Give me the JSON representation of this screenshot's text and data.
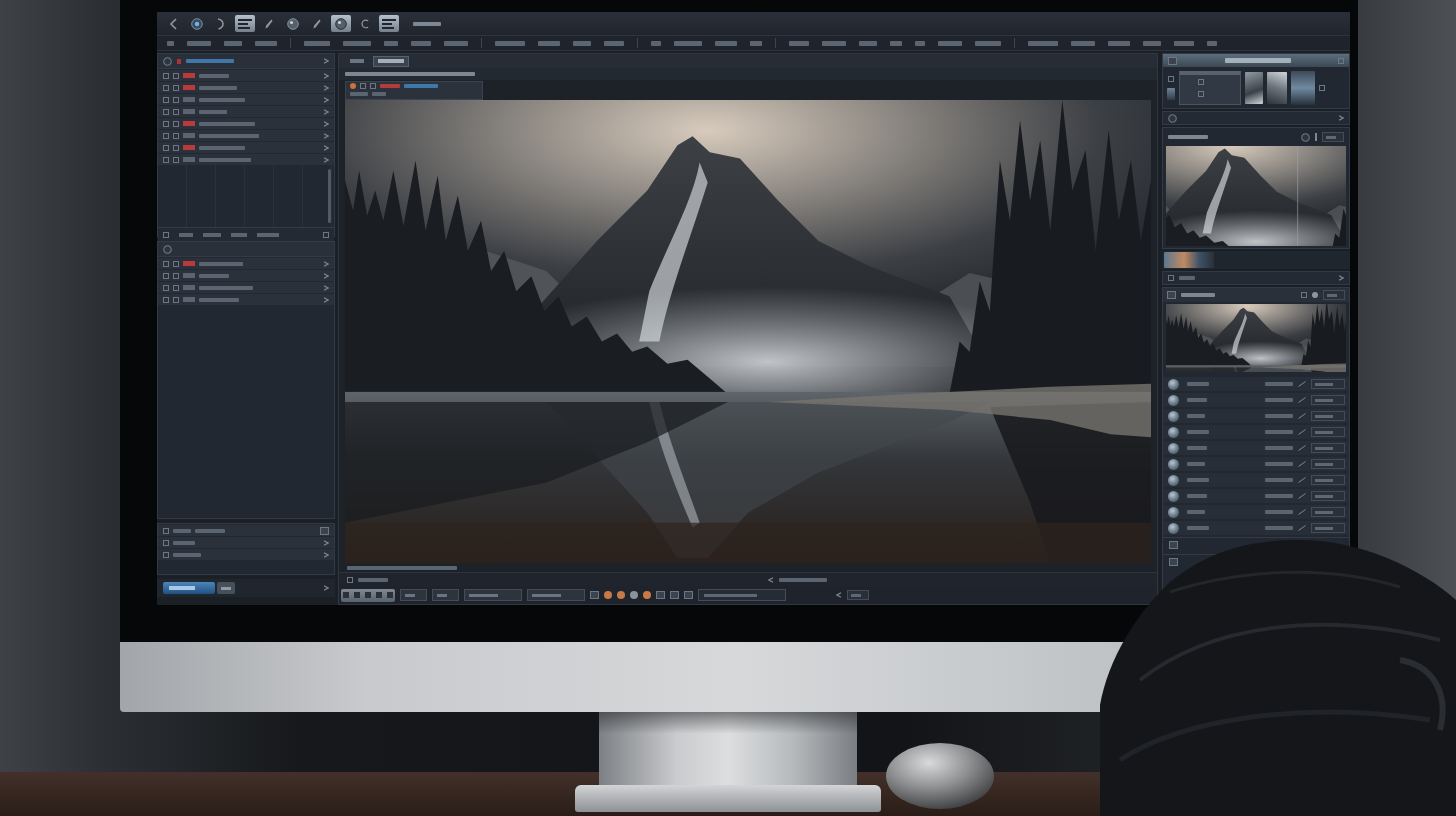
{
  "toolbar": {
    "tools": [
      {
        "kind": "back",
        "selected": false
      },
      {
        "kind": "dot",
        "selected": false
      },
      {
        "kind": "curve",
        "selected": false
      },
      {
        "kind": "bars",
        "selected": true
      },
      {
        "kind": "pen",
        "selected": false
      },
      {
        "kind": "lens",
        "selected": false
      },
      {
        "kind": "pen",
        "selected": false
      },
      {
        "kind": "lens",
        "selected": true
      },
      {
        "kind": "hook",
        "selected": false
      },
      {
        "kind": "bars",
        "selected": true
      }
    ]
  },
  "layers_panel": {
    "rows": [
      {
        "flagged": true
      },
      {
        "flagged": true
      },
      {
        "flagged": false
      },
      {
        "flagged": false
      },
      {
        "flagged": true
      },
      {
        "flagged": false
      },
      {
        "flagged": true
      },
      {
        "flagged": false
      }
    ]
  },
  "adjustments_panel": {
    "rows": [
      {
        "flagged": true
      },
      {
        "flagged": false
      },
      {
        "flagged": false
      },
      {
        "flagged": false
      }
    ]
  },
  "viewer": {
    "tabs": [
      {
        "selected": false
      },
      {
        "selected": true
      }
    ]
  },
  "presets_panel": {
    "rows": [
      {
        "selected": false
      },
      {
        "selected": false
      },
      {
        "selected": false
      },
      {
        "selected": false
      },
      {
        "selected": false
      },
      {
        "selected": false
      },
      {
        "selected": false
      },
      {
        "selected": false
      },
      {
        "selected": false
      },
      {
        "selected": false
      }
    ]
  }
}
